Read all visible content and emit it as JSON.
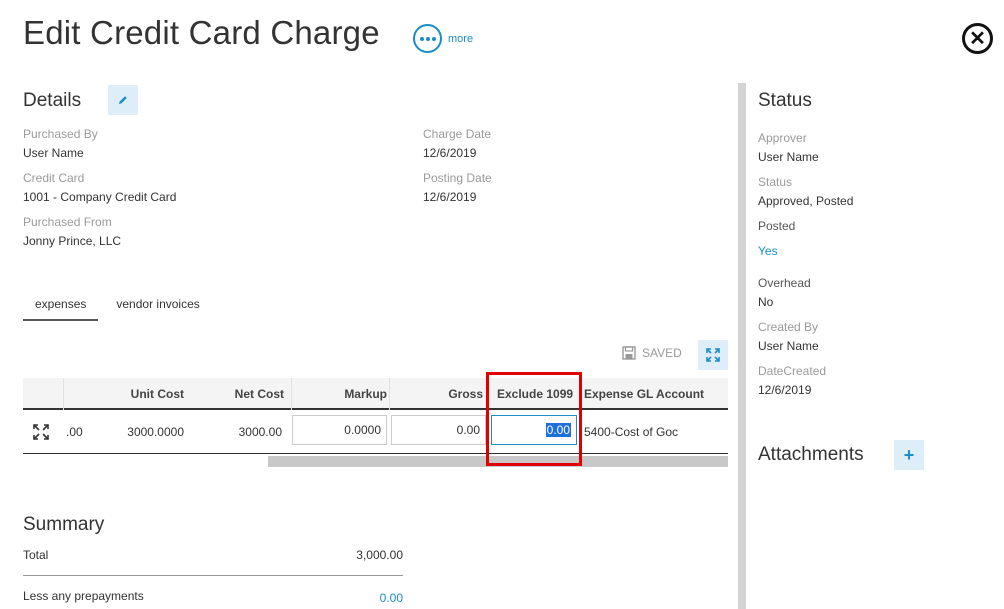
{
  "header": {
    "title": "Edit Credit Card Charge",
    "more_label": "more"
  },
  "details": {
    "heading": "Details",
    "purchased_by_label": "Purchased By",
    "purchased_by_value": "User Name",
    "credit_card_label": "Credit Card",
    "credit_card_value": "1001 - Company Credit Card",
    "purchased_from_label": "Purchased From",
    "purchased_from_value": "Jonny Prince, LLC",
    "charge_date_label": "Charge Date",
    "charge_date_value": "12/6/2019",
    "posting_date_label": "Posting Date",
    "posting_date_value": "12/6/2019"
  },
  "tabs": [
    {
      "label": "expenses",
      "active": true
    },
    {
      "label": "vendor invoices",
      "active": false
    }
  ],
  "grid": {
    "saved_label": "SAVED",
    "columns": [
      "Unit Cost",
      "Net Cost",
      "Markup",
      "Gross",
      "Exclude 1099",
      "Expense GL Account"
    ],
    "row": {
      "partial_value": ".00",
      "unit_cost": "3000.0000",
      "net_cost": "3000.00",
      "markup": "0.0000",
      "gross": "0.00",
      "exclude_1099": "0.00",
      "expense_gl_account": "5400-Cost of Goc"
    }
  },
  "summary": {
    "heading": "Summary",
    "total_label": "Total",
    "total_value": "3,000.00",
    "prepay_label": "Less any prepayments",
    "prepay_value": "0.00"
  },
  "status": {
    "heading": "Status",
    "approver_label": "Approver",
    "approver_value": "User Name",
    "status_label": "Status",
    "status_value": "Approved, Posted",
    "posted_label": "Posted",
    "posted_value": "Yes",
    "overhead_label": "Overhead",
    "overhead_value": "No",
    "created_by_label": "Created By",
    "created_by_value": "User Name",
    "date_created_label": "DateCreated",
    "date_created_value": "12/6/2019"
  },
  "attachments": {
    "heading": "Attachments"
  },
  "colors": {
    "accent": "#1a8dc8",
    "button_bg": "#ddeef8",
    "highlight": "#e00000"
  }
}
